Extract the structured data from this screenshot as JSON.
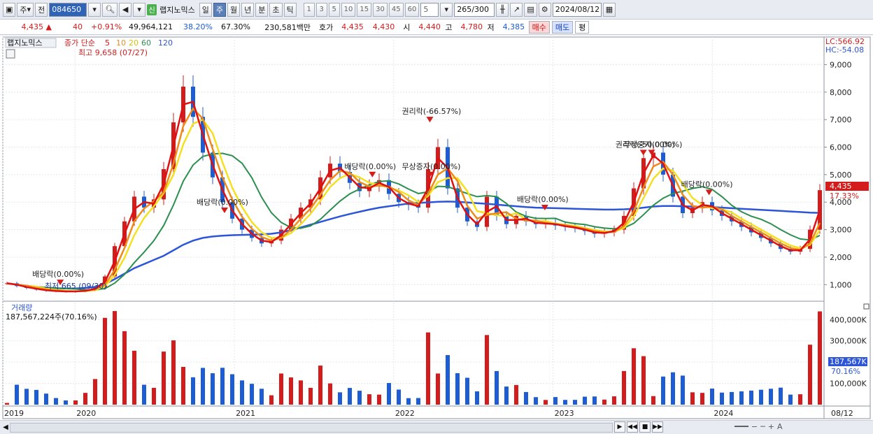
{
  "toolbar": {
    "period_label": "주",
    "prev_label": "전",
    "code": "084650",
    "new_badge": "신",
    "stock_name": "랩지노믹스",
    "period_tabs": [
      "일",
      "주",
      "월",
      "년",
      "분",
      "초",
      "틱"
    ],
    "active_tab": "주",
    "intervals": [
      "1",
      "3",
      "5",
      "10",
      "15",
      "30",
      "45",
      "60"
    ],
    "interval_value": "5",
    "count_value": "265",
    "count_total": "/300",
    "date": "2024/08/12"
  },
  "quote": {
    "price": "4,435",
    "change": "40",
    "change_pct": "+0.91%",
    "volume": "49,964,121",
    "turnover_pct": "38.20%",
    "ratio_pct": "67.30%",
    "amount": "230,581백만",
    "bid_label": "호가",
    "bid1": "4,435",
    "bid2": "4,430",
    "open_label": "시",
    "open": "4,440",
    "high_label": "고",
    "high": "4,780",
    "low_label": "저",
    "low": "4,385",
    "buy_label": "매수",
    "sell_label": "매도",
    "flat_label": "평"
  },
  "legend": {
    "name": "랩지노믹스",
    "ma_title": "종가 단순",
    "ma_periods": [
      "5",
      "10",
      "20",
      "60",
      "120"
    ],
    "volume_title": "거래량",
    "volume_value": "187,567,224주(70.16%)"
  },
  "axis": {
    "lc": "LC:566.92",
    "hc": "HC:-54.08",
    "price_ticks": [
      "9,000",
      "8,000",
      "7,000",
      "6,000",
      "5,000",
      "4,000",
      "3,000",
      "2,000",
      "1,000"
    ],
    "price_tick_values": [
      9000,
      8000,
      7000,
      6000,
      5000,
      4000,
      3000,
      2000,
      1000
    ],
    "current_price_label": "4,435",
    "current_pct_label": "17.33%",
    "volume_ticks": [
      "400,000K",
      "300,000K",
      "200,000K",
      "100,000K"
    ],
    "volume_tick_values": [
      400000,
      300000,
      200000,
      100000
    ],
    "current_volume_label": "187,567K",
    "current_volume_pct": "70.16%",
    "year_labels": [
      "2019",
      "2020",
      "2021",
      "2022",
      "2023",
      "2024",
      "08/12"
    ]
  },
  "annotations": {
    "high": "최고 9,658 (07/27)",
    "low": "최저 665 (09/30)",
    "events": [
      "배당락(0.00%)",
      "배당락(0.00%)",
      "권리락(-66.57%)",
      "배당락(0.00%)",
      "무상증자(0.00%)",
      "배당락(0.00%)",
      "권리락(-50.00%)",
      "무상증자(0.00%)",
      "배당락(0.00%)"
    ]
  },
  "colors": {
    "up": "#d41c1c",
    "down": "#1c5cd4",
    "ma5": "#e01010",
    "ma10": "#ee8c1a",
    "ma20": "#f4e020",
    "ma60": "#2b8f4e",
    "ma120": "#2d55d8"
  },
  "chart_data": {
    "type": "line",
    "title": "랩지노믹스",
    "xlabel": "",
    "ylabel": "",
    "ylim": [
      500,
      9900
    ],
    "x_label_years": [
      "2019",
      "2020",
      "2021",
      "2022",
      "2023",
      "2024"
    ],
    "series": [
      {
        "name": "종가",
        "values": [
          1050,
          950,
          880,
          820,
          780,
          760,
          750,
          760,
          800,
          900,
          1300,
          2400,
          3300,
          4200,
          3800,
          4100,
          5200,
          6900,
          8200,
          7100,
          5800,
          4900,
          4000,
          3400,
          3000,
          2700,
          2500,
          2600,
          3000,
          3400,
          3800,
          4100,
          4900,
          5400,
          5100,
          4700,
          4400,
          4600,
          4800,
          4300,
          4000,
          3900,
          3800,
          5200,
          6000,
          4500,
          3800,
          3300,
          3100,
          4200,
          3500,
          3200,
          3500,
          3300,
          3200,
          3250,
          3150,
          3100,
          3050,
          2950,
          2850,
          2900,
          3000,
          3500,
          4500,
          5600,
          5800,
          5000,
          4200,
          3600,
          3800,
          4000,
          3700,
          3500,
          3300,
          3100,
          2900,
          2700,
          2500,
          2300,
          2200,
          2300,
          3000,
          4435
        ]
      },
      {
        "name": "120",
        "values": [
          1050,
          1000,
          960,
          920,
          890,
          870,
          860,
          860,
          880,
          920,
          1020,
          1200,
          1400,
          1600,
          1750,
          1900,
          2050,
          2250,
          2450,
          2600,
          2700,
          2750,
          2780,
          2800,
          2810,
          2820,
          2830,
          2850,
          2900,
          2980,
          3080,
          3180,
          3280,
          3380,
          3480,
          3570,
          3650,
          3730,
          3800,
          3850,
          3900,
          3950,
          3970,
          3990,
          4010,
          4020,
          4010,
          3990,
          3960,
          3940,
          3910,
          3880,
          3850,
          3820,
          3800,
          3790,
          3780,
          3770,
          3760,
          3750,
          3740,
          3730,
          3730,
          3740,
          3760,
          3800,
          3840,
          3860,
          3860,
          3850,
          3840,
          3830,
          3820,
          3800,
          3780,
          3760,
          3740,
          3720,
          3700,
          3680,
          3660,
          3640,
          3620,
          3610
        ]
      }
    ]
  }
}
